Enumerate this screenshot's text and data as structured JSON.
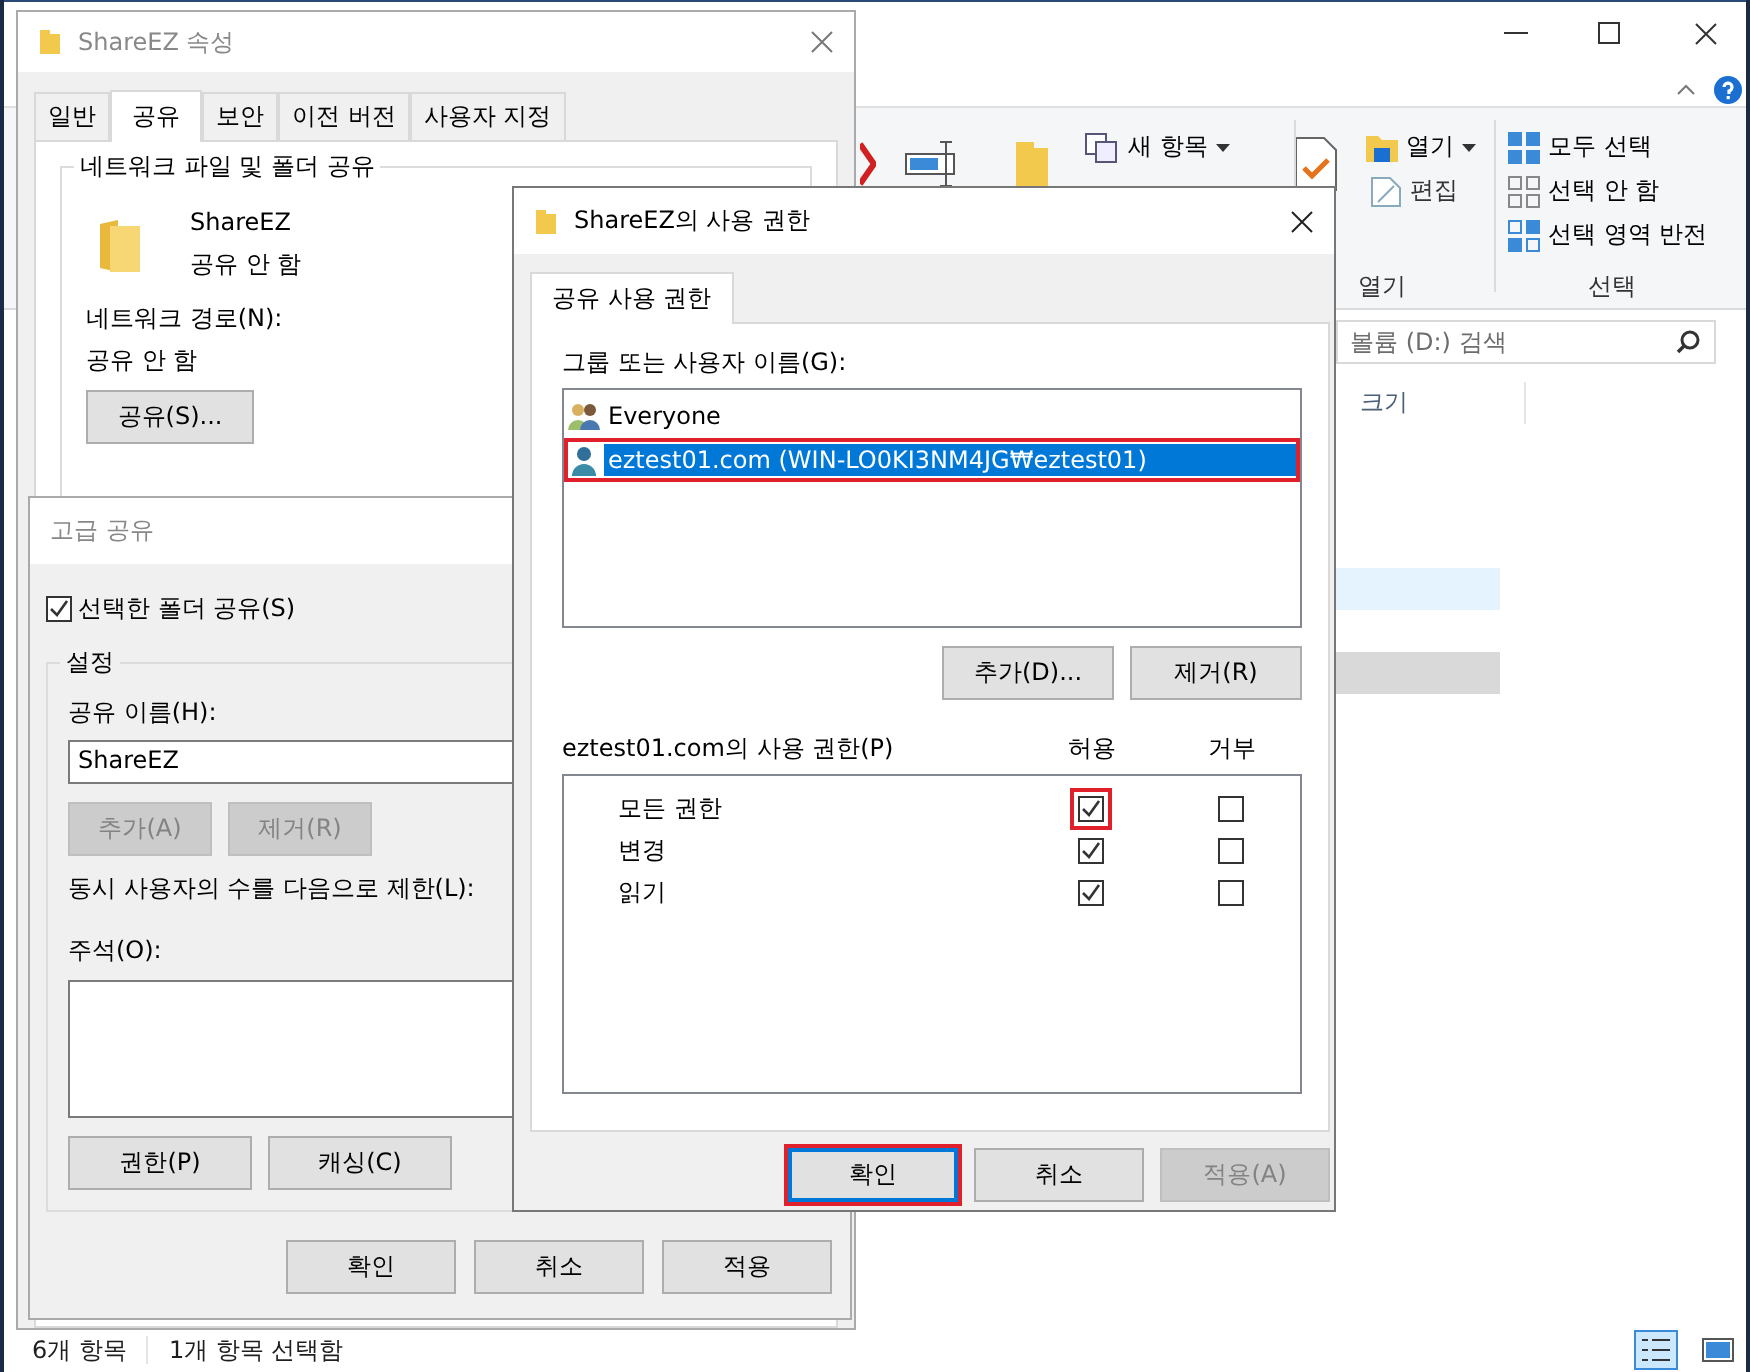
{
  "explorer": {
    "ribbon": {
      "new_item": "새 항목",
      "open": "열기",
      "edit": "편집",
      "open_group": "열기",
      "select_all": "모두 선택",
      "select_none": "선택 안 함",
      "invert_selection": "선택 영역 반전",
      "select_group": "선택"
    },
    "search": {
      "placeholder": "볼륨 (D:) 검색"
    },
    "columns": [
      "크기"
    ],
    "status_bar": {
      "item_count": "6개 항목",
      "selected_count": "1개 항목 선택함"
    }
  },
  "properties_window": {
    "title": "ShareEZ 속성",
    "tabs": [
      {
        "label": "일반",
        "selected": false
      },
      {
        "label": "공유",
        "selected": true
      },
      {
        "label": "보안",
        "selected": false
      },
      {
        "label": "이전 버전",
        "selected": false
      },
      {
        "label": "사용자 지정",
        "selected": false
      }
    ],
    "group_title": "네트워크 파일 및 폴더 공유",
    "folder_name": "ShareEZ",
    "share_status": "공유 안 함",
    "network_path_label": "네트워크 경로(N):",
    "network_path": "공유 안 함",
    "share_button": "공유(S)..."
  },
  "advanced_sharing": {
    "title": "고급 공유",
    "share_checkbox": {
      "label": "선택한 폴더 공유(S)",
      "checked": true
    },
    "settings_title": "설정",
    "share_name_label": "공유 이름(H):",
    "share_name": "ShareEZ",
    "name_buttons": [
      {
        "label": "추가(A)",
        "disabled": true
      },
      {
        "label": "제거(R)",
        "disabled": true
      }
    ],
    "limit_label": "동시 사용자의 수를 다음으로 제한(L):",
    "comment_label": "주석(O):",
    "buttons": [
      "권한(P)",
      "캐싱(C)"
    ],
    "footer_buttons": [
      "확인",
      "취소",
      "적용"
    ]
  },
  "permissions_dialog": {
    "title": "ShareEZ의 사용 권한",
    "tabs": [
      {
        "label": "공유 사용 권한",
        "selected": true
      }
    ],
    "users_label": "그룹 또는 사용자 이름(G):",
    "users": [
      {
        "name": "Everyone",
        "kind": "group",
        "selected": false,
        "highlighted": false
      },
      {
        "name": "eztest01.com (WIN-LO0KI3NM4JG₩eztest01)",
        "kind": "user",
        "selected": true,
        "highlighted": true
      }
    ],
    "user_buttons": [
      "추가(D)...",
      "제거(R)"
    ],
    "permissions_label": "eztest01.com의 사용 권한(P)",
    "columns": [
      "허용",
      "거부"
    ],
    "permissions": [
      {
        "name": "모든 권한",
        "allow": true,
        "deny": false,
        "highlighted": true
      },
      {
        "name": "변경",
        "allow": true,
        "deny": false,
        "highlighted": false
      },
      {
        "name": "읽기",
        "allow": true,
        "deny": false,
        "highlighted": false
      }
    ],
    "buttons": [
      {
        "label": "확인",
        "disabled": false,
        "highlighted": true
      },
      {
        "label": "취소",
        "disabled": false,
        "highlighted": false
      },
      {
        "label": "적용(A)",
        "disabled": true,
        "highlighted": false
      }
    ]
  }
}
